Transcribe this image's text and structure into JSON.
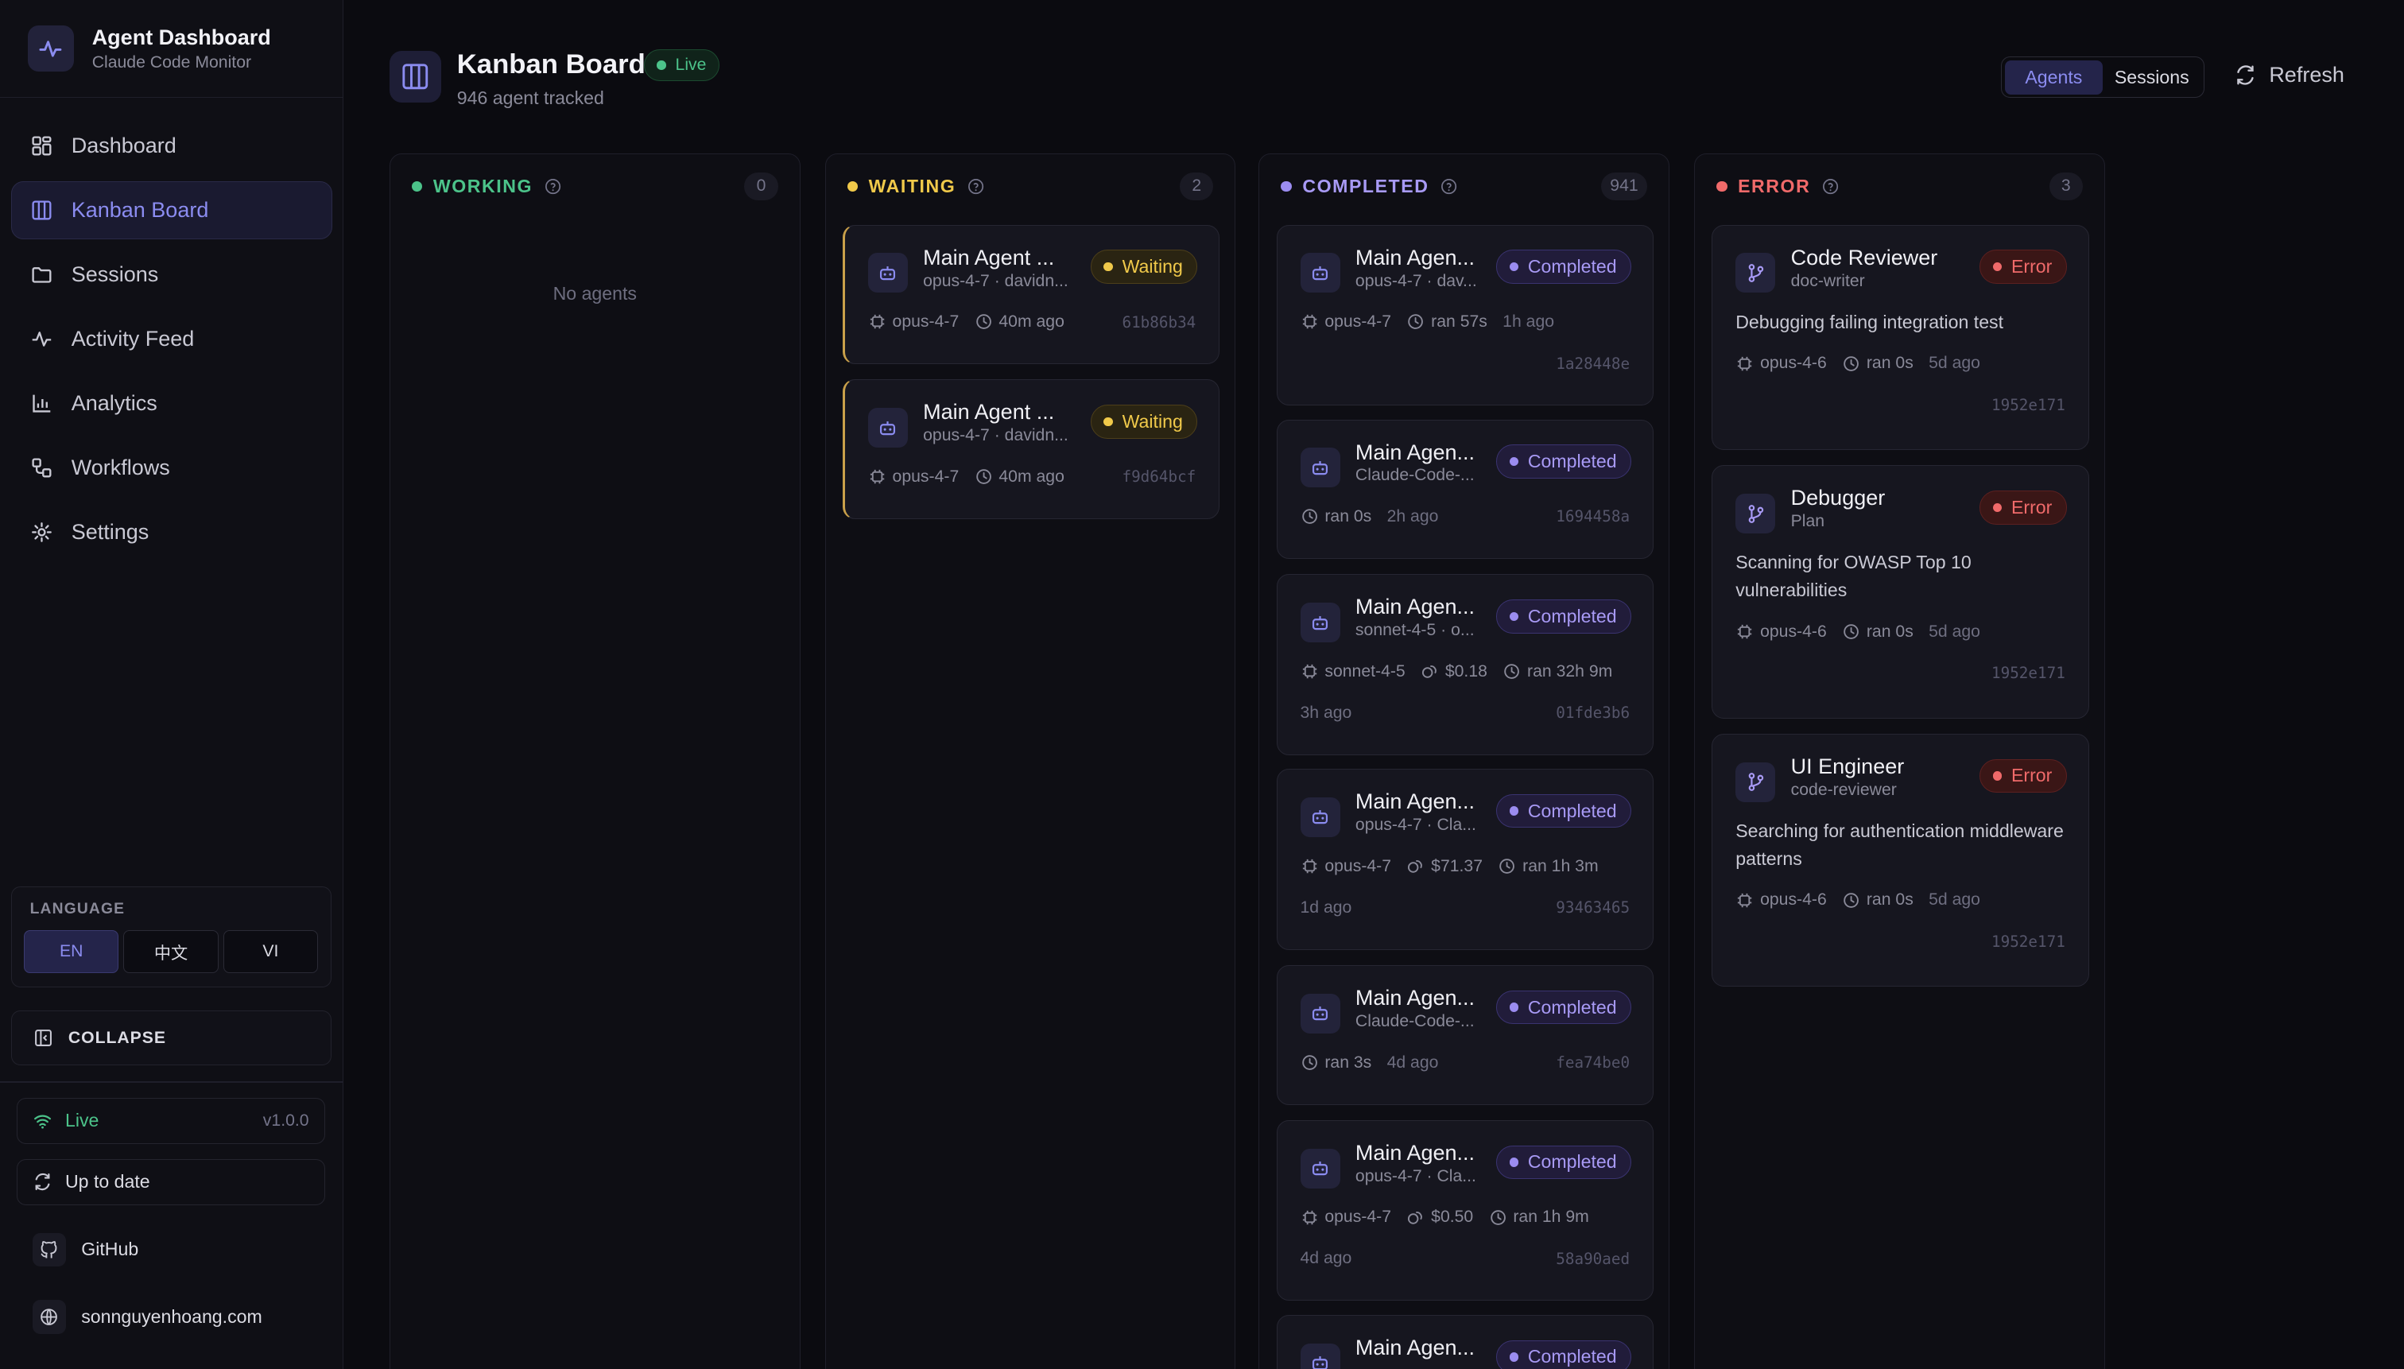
{
  "brand": {
    "title": "Agent Dashboard",
    "subtitle": "Claude Code Monitor"
  },
  "nav": [
    {
      "label": "Dashboard",
      "icon": "grid-icon"
    },
    {
      "label": "Kanban Board",
      "icon": "columns-icon",
      "active": true
    },
    {
      "label": "Sessions",
      "icon": "folder-icon"
    },
    {
      "label": "Activity Feed",
      "icon": "activity-icon"
    },
    {
      "label": "Analytics",
      "icon": "bar-chart-icon"
    },
    {
      "label": "Workflows",
      "icon": "workflow-icon"
    },
    {
      "label": "Settings",
      "icon": "gear-icon"
    }
  ],
  "language": {
    "title": "LANGUAGE",
    "options": [
      "EN",
      "中文",
      "VI"
    ],
    "selected": "EN"
  },
  "collapse_label": "COLLAPSE",
  "status": {
    "live": "Live",
    "version": "v1.0.0",
    "update": "Up to date"
  },
  "links": {
    "github": "GitHub",
    "website": "sonnguyenhoang.com"
  },
  "header": {
    "title": "Kanban Board",
    "live_badge": "Live",
    "subtitle": "946 agent tracked",
    "toggle": [
      "Agents",
      "Sessions"
    ],
    "refresh": "Refresh"
  },
  "colors": {
    "working": "#4cc38a",
    "waiting": "#f0c94a",
    "completed": "#9b8cf0",
    "error": "#f06a6a",
    "accent": "#8b8cf0"
  },
  "columns": {
    "working": {
      "title": "WORKING",
      "count": "0",
      "empty": "No agents"
    },
    "waiting": {
      "title": "WAITING",
      "count": "2",
      "cards": [
        {
          "name": "Main Agent ...",
          "sub": "opus-4-7 · davidn...",
          "status": "Waiting",
          "model": "opus-4-7",
          "time": "40m ago",
          "hash": "61b86b34"
        },
        {
          "name": "Main Agent ...",
          "sub": "opus-4-7 · davidn...",
          "status": "Waiting",
          "model": "opus-4-7",
          "time": "40m ago",
          "hash": "f9d64bcf"
        }
      ]
    },
    "completed": {
      "title": "COMPLETED",
      "count": "941",
      "cards": [
        {
          "name": "Main Agen...",
          "sub": "opus-4-7 · dav...",
          "status": "Completed",
          "model": "opus-4-7",
          "ran": "ran 57s",
          "ago": "1h ago",
          "hash": "1a28448e"
        },
        {
          "name": "Main Agen...",
          "sub": "Claude-Code-...",
          "status": "Completed",
          "ran": "ran 0s",
          "ago": "2h ago",
          "hash": "1694458a"
        },
        {
          "name": "Main Agen...",
          "sub": "sonnet-4-5 · o...",
          "status": "Completed",
          "model": "sonnet-4-5",
          "cost": "$0.18",
          "ran": "ran 32h 9m",
          "ago": "3h ago",
          "hash": "01fde3b6"
        },
        {
          "name": "Main Agen...",
          "sub": "opus-4-7 · Cla...",
          "status": "Completed",
          "model": "opus-4-7",
          "cost": "$71.37",
          "ran": "ran 1h 3m",
          "ago": "1d ago",
          "hash": "93463465"
        },
        {
          "name": "Main Agen...",
          "sub": "Claude-Code-...",
          "status": "Completed",
          "ran": "ran 3s",
          "ago": "4d ago",
          "hash": "fea74be0"
        },
        {
          "name": "Main Agen...",
          "sub": "opus-4-7 · Cla...",
          "status": "Completed",
          "model": "opus-4-7",
          "cost": "$0.50",
          "ran": "ran 1h 9m",
          "ago": "4d ago",
          "hash": "58a90aed"
        },
        {
          "name": "Main Agen...",
          "status": "Completed"
        }
      ]
    },
    "error": {
      "title": "ERROR",
      "count": "3",
      "cards": [
        {
          "name": "Code Reviewer",
          "sub": "doc-writer",
          "status": "Error",
          "desc": "Debugging failing integration test",
          "model": "opus-4-6",
          "ran": "ran 0s",
          "ago": "5d ago",
          "hash": "1952e171"
        },
        {
          "name": "Debugger",
          "sub": "Plan",
          "status": "Error",
          "desc": "Scanning for OWASP Top 10 vulnerabilities",
          "model": "opus-4-6",
          "ran": "ran 0s",
          "ago": "5d ago",
          "hash": "1952e171"
        },
        {
          "name": "UI Engineer",
          "sub": "code-reviewer",
          "status": "Error",
          "desc": "Searching for authentication middleware patterns",
          "model": "opus-4-6",
          "ran": "ran 0s",
          "ago": "5d ago",
          "hash": "1952e171"
        }
      ]
    }
  }
}
